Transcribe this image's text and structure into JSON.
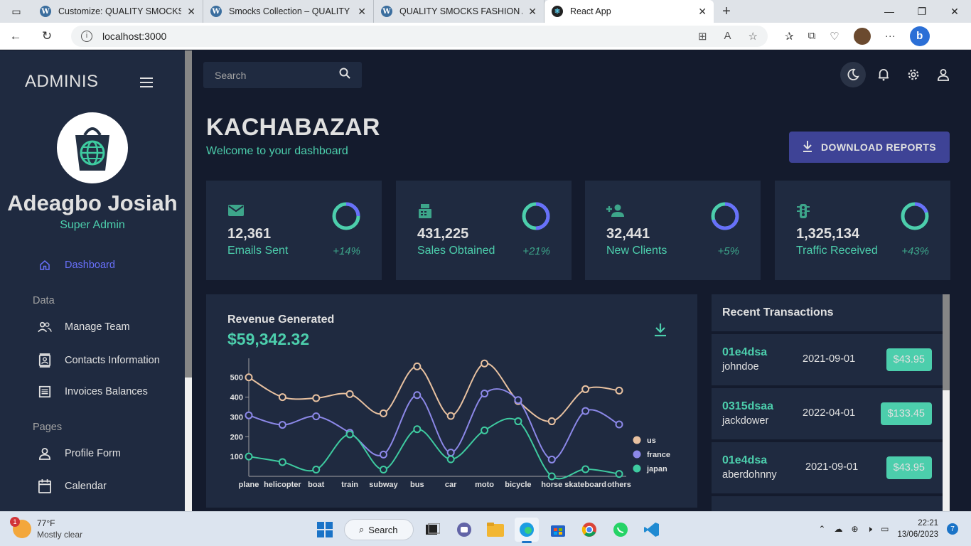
{
  "browser": {
    "tabs": [
      {
        "title": "Customize: QUALITY SMOCKS FA",
        "icon": "wordpress-icon"
      },
      {
        "title": "Smocks Collection – QUALITY SM",
        "icon": "wordpress-icon"
      },
      {
        "title": "QUALITY SMOCKS FASHION AND",
        "icon": "wordpress-icon"
      },
      {
        "title": "React App",
        "icon": "react-icon"
      }
    ],
    "url": "localhost:3000"
  },
  "sidebar": {
    "brand": "ADMINIS",
    "user_name": "Adeagbo Josiah",
    "user_role": "Super Admin",
    "dashboard": "Dashboard",
    "section_data": "Data",
    "section_pages": "Pages",
    "items": [
      {
        "label": "Manage Team",
        "icon": "team-icon"
      },
      {
        "label": "Contacts Information",
        "icon": "contacts-icon"
      },
      {
        "label": "Invoices Balances",
        "icon": "receipt-icon"
      },
      {
        "label": "Profile Form",
        "icon": "person-icon"
      },
      {
        "label": "Calendar",
        "icon": "calendar-icon"
      }
    ]
  },
  "topbar": {
    "search_placeholder": "Search"
  },
  "header": {
    "title": "KACHABAZAR",
    "subtitle": "Welcome to your dashboard",
    "download_label": "DOWNLOAD REPORTS"
  },
  "stats": [
    {
      "value": "12,361",
      "label": "Emails Sent",
      "increase": "+14%",
      "progress": 0.75,
      "icon": "email-icon"
    },
    {
      "value": "431,225",
      "label": "Sales Obtained",
      "increase": "+21%",
      "progress": 0.5,
      "icon": "point-of-sale-icon"
    },
    {
      "value": "32,441",
      "label": "New Clients",
      "increase": "+5%",
      "progress": 0.3,
      "icon": "person-add-icon"
    },
    {
      "value": "1,325,134",
      "label": "Traffic Received",
      "increase": "+43%",
      "progress": 0.8,
      "icon": "traffic-icon"
    }
  ],
  "revenue": {
    "title": "Revenue Generated",
    "value": "$59,342.32"
  },
  "chart_data": {
    "type": "line",
    "categories": [
      "plane",
      "helicopter",
      "boat",
      "train",
      "subway",
      "bus",
      "car",
      "moto",
      "bicycle",
      "horse",
      "skateboard",
      "others"
    ],
    "yticks": [
      100,
      200,
      300,
      400,
      500
    ],
    "ylim": [
      0,
      560
    ],
    "series": [
      {
        "name": "us",
        "color": "#e8c1a0",
        "values": [
          500,
          400,
          395,
          415,
          318,
          555,
          305,
          570,
          380,
          278,
          440,
          433
        ]
      },
      {
        "name": "france",
        "color": "#8c88e8",
        "values": [
          308,
          260,
          303,
          220,
          110,
          410,
          120,
          418,
          385,
          85,
          330,
          262
        ]
      },
      {
        "name": "japan",
        "color": "#3ecba0",
        "values": [
          100,
          72,
          34,
          212,
          34,
          238,
          86,
          232,
          278,
          0,
          36,
          12
        ]
      }
    ]
  },
  "transactions": {
    "title": "Recent Transactions",
    "rows": [
      {
        "id": "01e4dsa",
        "user": "johndoe",
        "date": "2021-09-01",
        "cost": "$43.95"
      },
      {
        "id": "0315dsaa",
        "user": "jackdower",
        "date": "2022-04-01",
        "cost": "$133.45"
      },
      {
        "id": "01e4dsa",
        "user": "aberdohnny",
        "date": "2021-09-01",
        "cost": "$43.95"
      }
    ]
  },
  "taskbar": {
    "temp": "77°F",
    "weather": "Mostly clear",
    "badge": "1",
    "search": "Search",
    "time": "22:21",
    "date": "13/06/2023",
    "notif": "7"
  },
  "colors": {
    "accent_green": "#4cceac",
    "accent_blue": "#6870fa",
    "panel": "#1f2a40",
    "bg": "#141b2d"
  }
}
